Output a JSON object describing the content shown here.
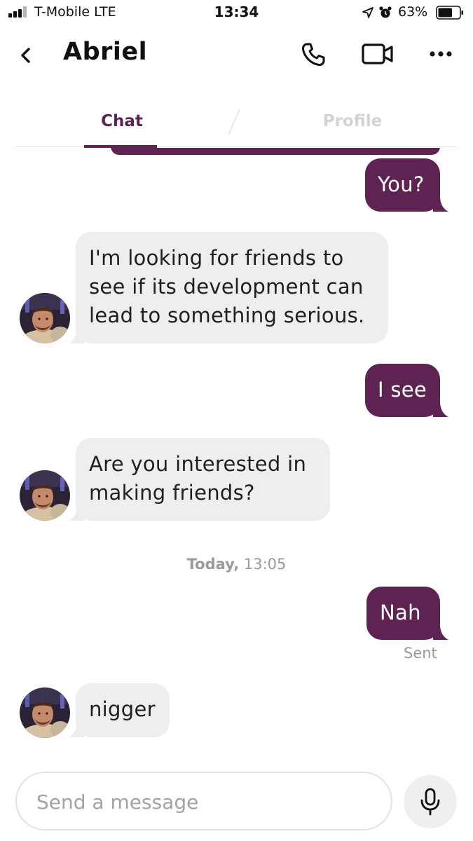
{
  "status_bar": {
    "carrier": "T-Mobile  LTE",
    "time": "13:34",
    "battery_percent": "63%",
    "battery_level": 0.63,
    "signal_bars_active": 3
  },
  "header": {
    "title": "Abriel"
  },
  "tabs": [
    {
      "label": "Chat",
      "active": true
    },
    {
      "label": "Profile",
      "active": false
    }
  ],
  "messages": [
    {
      "direction": "out",
      "text": "You?"
    },
    {
      "direction": "in",
      "text": "I'm looking for friends to\nsee if its development can\nlead to something serious."
    },
    {
      "direction": "out",
      "text": "I see"
    },
    {
      "direction": "in",
      "text": "Are you interested in\nmaking friends?"
    },
    {
      "direction": "out",
      "text": "Nah",
      "status": "Sent"
    },
    {
      "direction": "in",
      "text": "nigger"
    }
  ],
  "date_separator": {
    "day": "Today,",
    "time": "13:05"
  },
  "composer": {
    "placeholder": "Send a message"
  },
  "colors": {
    "accent": "#5e2353",
    "incoming_bubble": "#eeeeee",
    "muted_text": "#9a9a9a"
  },
  "icons": {
    "back": "chevron-left-icon",
    "call": "phone-icon",
    "video": "video-camera-icon",
    "more": "more-dots-icon",
    "mic": "microphone-icon"
  }
}
